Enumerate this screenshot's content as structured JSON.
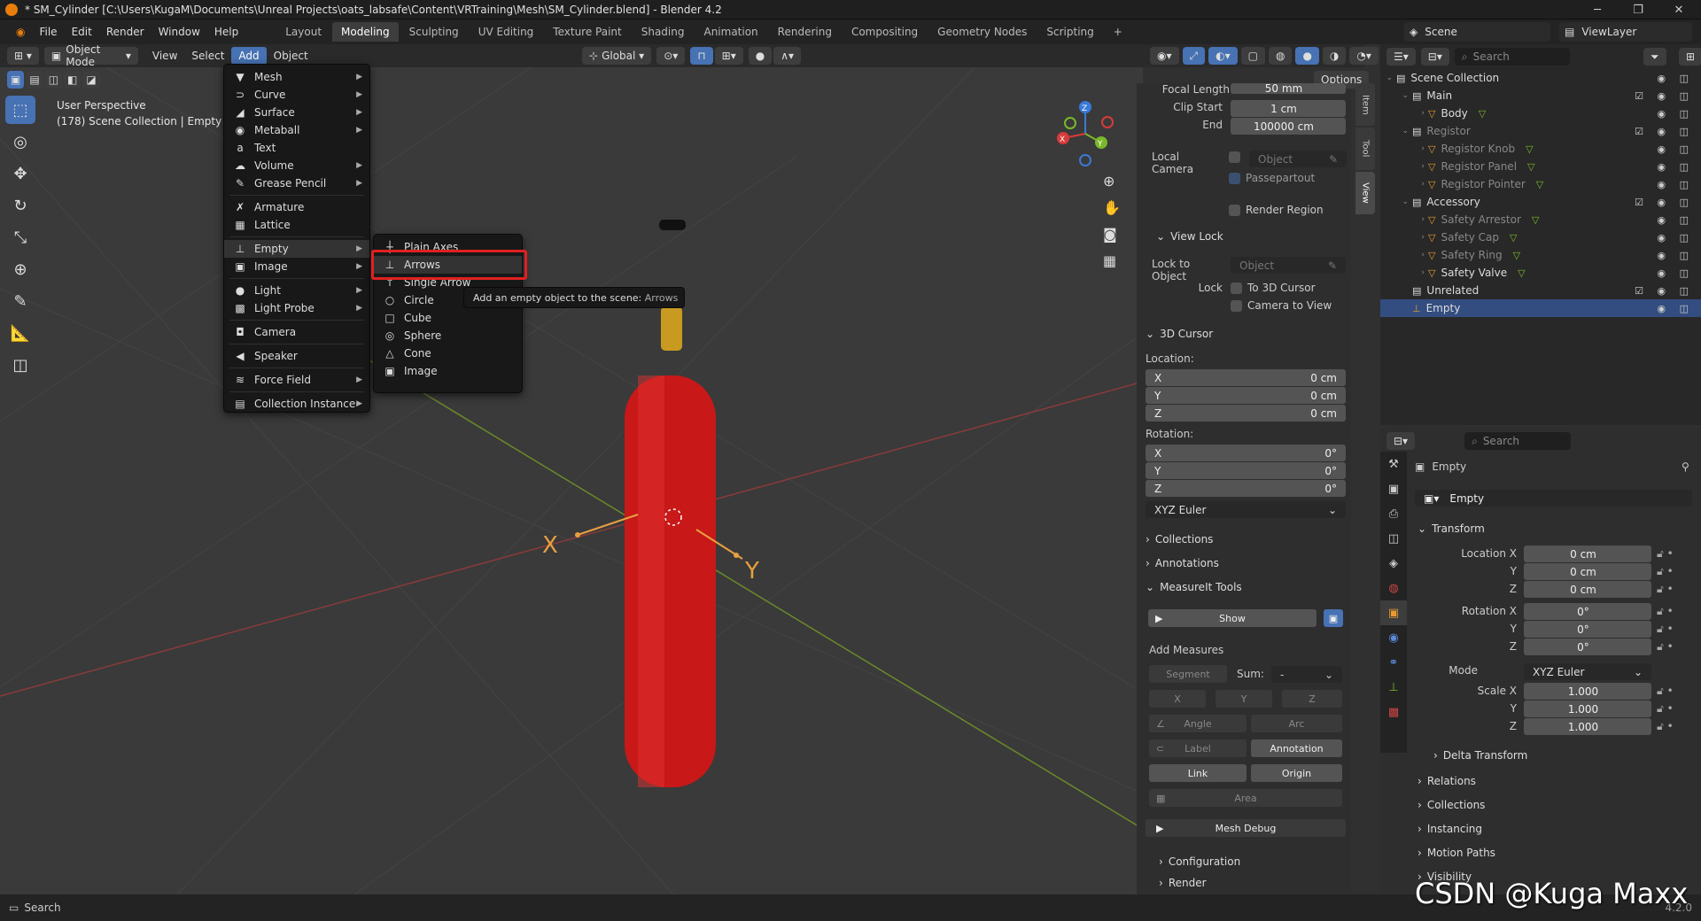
{
  "window": {
    "title": "* SM_Cylinder [C:\\Users\\KugaM\\Documents\\Unreal Projects\\oats_labsafe\\Content\\VRTraining\\Mesh\\SM_Cylinder.blend] - Blender 4.2"
  },
  "topmenu": [
    "File",
    "Edit",
    "Render",
    "Window",
    "Help"
  ],
  "workspaces": [
    "Layout",
    "Modeling",
    "Sculpting",
    "UV Editing",
    "Texture Paint",
    "Shading",
    "Animation",
    "Rendering",
    "Compositing",
    "Geometry Nodes",
    "Scripting"
  ],
  "active_workspace": "Modeling",
  "scene": {
    "name": "Scene",
    "viewlayer": "ViewLayer"
  },
  "header": {
    "mode": "Object Mode",
    "menus": [
      "View",
      "Select",
      "Add",
      "Object"
    ],
    "transform": "Global",
    "options": "Options"
  },
  "viewport": {
    "perspective": "User Perspective",
    "collection": "(178) Scene Collection | Empty"
  },
  "add_menu": [
    {
      "label": "Mesh",
      "icon": "▼",
      "sub": true
    },
    {
      "label": "Curve",
      "icon": "⊃",
      "sub": true
    },
    {
      "label": "Surface",
      "icon": "◢",
      "sub": true
    },
    {
      "label": "Metaball",
      "icon": "◉",
      "sub": true
    },
    {
      "label": "Text",
      "icon": "a",
      "sub": false
    },
    {
      "label": "Volume",
      "icon": "☁",
      "sub": true
    },
    {
      "label": "Grease Pencil",
      "icon": "✎",
      "sub": true
    },
    {
      "label": "Armature",
      "icon": "✗",
      "sub": false
    },
    {
      "label": "Lattice",
      "icon": "▦",
      "sub": false
    },
    {
      "label": "Empty",
      "icon": "⊥",
      "sub": true
    },
    {
      "label": "Image",
      "icon": "▣",
      "sub": true
    },
    {
      "label": "Light",
      "icon": "●",
      "sub": true
    },
    {
      "label": "Light Probe",
      "icon": "▩",
      "sub": true
    },
    {
      "label": "Camera",
      "icon": "◘",
      "sub": false
    },
    {
      "label": "Speaker",
      "icon": "◀",
      "sub": false
    },
    {
      "label": "Force Field",
      "icon": "≋",
      "sub": true
    },
    {
      "label": "Collection Instance",
      "icon": "▤",
      "sub": true
    }
  ],
  "empty_menu": [
    {
      "label": "Plain Axes",
      "icon": "┼"
    },
    {
      "label": "Arrows",
      "icon": "⊥"
    },
    {
      "label": "Single Arrow",
      "icon": "↑"
    },
    {
      "label": "Circle",
      "icon": "○"
    },
    {
      "label": "Cube",
      "icon": "□"
    },
    {
      "label": "Sphere",
      "icon": "◎"
    },
    {
      "label": "Cone",
      "icon": "△"
    },
    {
      "label": "Image",
      "icon": "▣"
    }
  ],
  "tooltip": {
    "text": "Add an empty object to the scene:",
    "target": "Arrows"
  },
  "npanel": {
    "tabs": [
      "Item",
      "Tool",
      "View"
    ],
    "focal_length": {
      "label": "Focal Length",
      "value": "50 mm"
    },
    "clip_start": {
      "label": "Clip Start",
      "value": "1 cm"
    },
    "clip_end": {
      "label": "End",
      "value": "100000 cm"
    },
    "local_camera": "Local Camera",
    "local_camera_ph": "Object",
    "passepartout": "Passepartout",
    "render_region": "Render Region",
    "view_lock": "View Lock",
    "lock_to_object": "Lock to Object",
    "lock_obj_ph": "Object",
    "lock": "Lock",
    "to_3d_cursor": "To 3D Cursor",
    "camera_to_view": "Camera to View",
    "cursor": "3D Cursor",
    "location": "Location:",
    "rotation": "Rotation:",
    "loc": [
      {
        "axis": "X",
        "value": "0 cm"
      },
      {
        "axis": "Y",
        "value": "0 cm"
      },
      {
        "axis": "Z",
        "value": "0 cm"
      }
    ],
    "rot": [
      {
        "axis": "X",
        "value": "0°"
      },
      {
        "axis": "Y",
        "value": "0°"
      },
      {
        "axis": "Z",
        "value": "0°"
      }
    ],
    "rot_mode": "XYZ Euler",
    "collections": "Collections",
    "annotations": "Annotations",
    "measureit": "MeasureIt Tools",
    "show": "Show",
    "add_measures": "Add Measures",
    "segment": "Segment",
    "sum": "Sum:",
    "sum_val": "-",
    "x": "X",
    "y": "Y",
    "z": "Z",
    "angle": "Angle",
    "arc": "Arc",
    "label": "Label",
    "annotation": "Annotation",
    "link": "Link",
    "origin": "Origin",
    "area": "Area",
    "mesh_debug": "Mesh Debug",
    "configuration": "Configuration",
    "render": "Render"
  },
  "outliner": {
    "search": "Search",
    "rows": [
      {
        "label": "Scene Collection",
        "indent": 0,
        "icon": "▤",
        "dim": false
      },
      {
        "label": "Main",
        "indent": 1,
        "icon": "▤",
        "dim": false
      },
      {
        "label": "Body",
        "indent": 2,
        "icon": "▽",
        "dim": false
      },
      {
        "label": "Registor",
        "indent": 1,
        "icon": "▤",
        "dim": true
      },
      {
        "label": "Registor Knob",
        "indent": 2,
        "icon": "▽",
        "dim": true
      },
      {
        "label": "Registor Panel",
        "indent": 2,
        "icon": "▽",
        "dim": true
      },
      {
        "label": "Registor Pointer",
        "indent": 2,
        "icon": "▽",
        "dim": true
      },
      {
        "label": "Accessory",
        "indent": 1,
        "icon": "▤",
        "dim": false
      },
      {
        "label": "Safety Arrestor",
        "indent": 2,
        "icon": "▽",
        "dim": true
      },
      {
        "label": "Safety Cap",
        "indent": 2,
        "icon": "▽",
        "dim": true
      },
      {
        "label": "Safety Ring",
        "indent": 2,
        "icon": "▽",
        "dim": true
      },
      {
        "label": "Safety Valve",
        "indent": 2,
        "icon": "▽",
        "dim": false
      },
      {
        "label": "Unrelated",
        "indent": 1,
        "icon": "▤",
        "dim": false
      },
      {
        "label": "Empty",
        "indent": 1,
        "icon": "⊥",
        "dim": false
      }
    ]
  },
  "properties": {
    "search": "Search",
    "object": "Empty",
    "data_name": "Empty",
    "transform": "Transform",
    "location": [
      {
        "label": "Location X",
        "value": "0 cm"
      },
      {
        "label": "Y",
        "value": "0 cm"
      },
      {
        "label": "Z",
        "value": "0 cm"
      }
    ],
    "rotation": [
      {
        "label": "Rotation X",
        "value": "0°"
      },
      {
        "label": "Y",
        "value": "0°"
      },
      {
        "label": "Z",
        "value": "0°"
      }
    ],
    "mode_label": "Mode",
    "mode": "XYZ Euler",
    "scale": [
      {
        "label": "Scale X",
        "value": "1.000"
      },
      {
        "label": "Y",
        "value": "1.000"
      },
      {
        "label": "Z",
        "value": "1.000"
      }
    ],
    "sections": [
      "Delta Transform",
      "Relations",
      "Collections",
      "Instancing",
      "Motion Paths",
      "Visibility"
    ]
  },
  "status": {
    "search": "Search",
    "version": "4.2.0"
  },
  "watermark": "CSDN @Kuga Maxx",
  "axes": {
    "x": "X",
    "y": "Y",
    "z": "Z"
  }
}
